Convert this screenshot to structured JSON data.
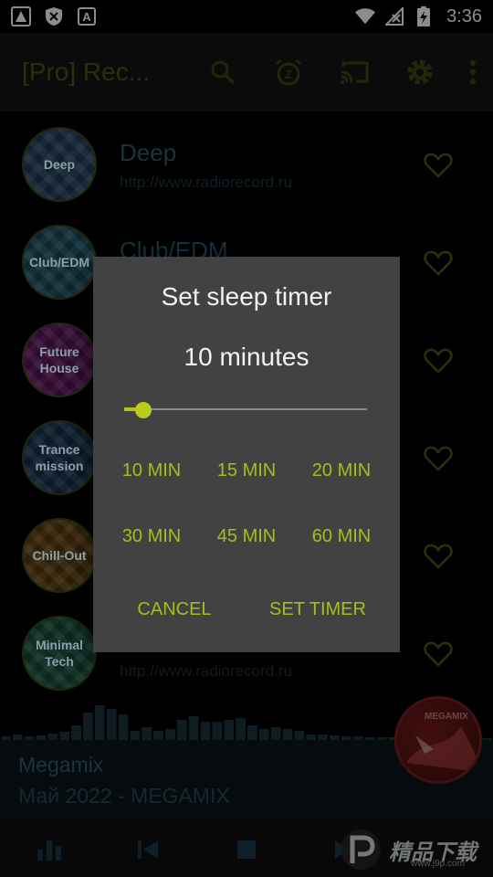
{
  "status": {
    "time": "3:36"
  },
  "appbar": {
    "title": "[Pro] Rec...",
    "actions": [
      "search-icon",
      "sleep-timer-icon",
      "cast-icon",
      "settings-icon",
      "more-vert-icon"
    ]
  },
  "stations": [
    {
      "logo": "Deep",
      "name": "Deep",
      "url": "http://www.radiorecord.ru",
      "color": "#2a4a6a"
    },
    {
      "logo": "Club/EDM",
      "name": "Club/EDM",
      "url": "",
      "color": "#1f5a6e"
    },
    {
      "logo": "Future House",
      "name": "",
      "url": "",
      "color": "#6a1a6a"
    },
    {
      "logo": "Trance mission",
      "name": "",
      "url": "",
      "color": "#1c3a5a"
    },
    {
      "logo": "Chill-Out",
      "name": "",
      "url": "",
      "color": "#6a4a14"
    },
    {
      "logo": "Minimal Tech",
      "name": "",
      "url": "http://www.radiorecord.ru",
      "color": "#1c5a44"
    }
  ],
  "player": {
    "title": "Megamix",
    "subtitle": "Май 2022 - MEGAMIX",
    "art_label": "MEGAMIX",
    "equalizer": [
      4,
      6,
      4,
      5,
      7,
      9,
      16,
      30,
      38,
      34,
      28,
      10,
      14,
      10,
      12,
      22,
      26,
      20,
      20,
      22,
      24,
      16,
      12,
      14,
      12,
      10,
      6,
      6,
      5,
      4,
      4,
      3,
      3,
      3,
      2,
      2,
      2,
      2,
      2,
      2,
      2,
      2
    ]
  },
  "dialog": {
    "title": "Set sleep timer",
    "value": "10 minutes",
    "slider_fraction": 0.08,
    "presets": [
      "10 MIN",
      "15 MIN",
      "20 MIN",
      "30 MIN",
      "45 MIN",
      "60 MIN"
    ],
    "cancel": "CANCEL",
    "confirm": "SET TIMER"
  },
  "watermark": {
    "text": "精品下载",
    "sub": "www.j9p.com"
  },
  "colors": {
    "accent": "#a8bc1e",
    "dialog_bg": "#424242"
  }
}
